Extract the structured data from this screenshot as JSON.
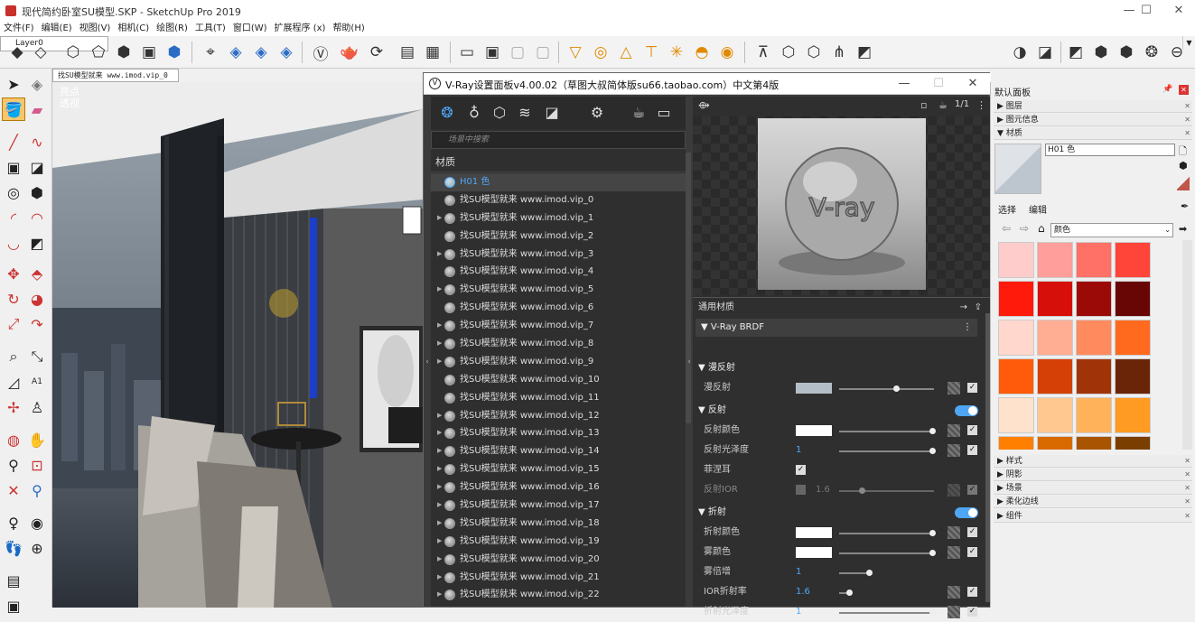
{
  "window": {
    "title": "现代简约卧室SU模型.SKP - SketchUp Pro 2019",
    "min": "—",
    "max": "☐",
    "close": "✕"
  },
  "menu": [
    "文件(F)",
    "编辑(E)",
    "视图(V)",
    "相机(C)",
    "绘图(R)",
    "工具(T)",
    "窗口(W)",
    "扩展程序 (x)",
    "帮助(H)"
  ],
  "toolbar": {
    "layer": "Layer0"
  },
  "scene_tab": "找SU模型就来 www.imod.vip_0",
  "viewport_labels": {
    "style": "亮点",
    "projection": "透视"
  },
  "vray": {
    "title": "V-Ray设置面板v4.00.02（草图大叔简体版su66.taobao.com）中文第4版",
    "search_placeholder": "场景中搜索",
    "materials_header": "材质",
    "selected_material": "H01 色",
    "materials": [
      "找SU模型就来 www.imod.vip_0",
      "找SU模型就来 www.imod.vip_1",
      "找SU模型就来 www.imod.vip_2",
      "找SU模型就来 www.imod.vip_3",
      "找SU模型就来 www.imod.vip_4",
      "找SU模型就来 www.imod.vip_5",
      "找SU模型就来 www.imod.vip_6",
      "找SU模型就来 www.imod.vip_7",
      "找SU模型就来 www.imod.vip_8",
      "找SU模型就来 www.imod.vip_9",
      "找SU模型就来 www.imod.vip_10",
      "找SU模型就来 www.imod.vip_11",
      "找SU模型就来 www.imod.vip_12",
      "找SU模型就来 www.imod.vip_13",
      "找SU模型就来 www.imod.vip_14",
      "找SU模型就来 www.imod.vip_15",
      "找SU模型就来 www.imod.vip_16",
      "找SU模型就来 www.imod.vip_17",
      "找SU模型就来 www.imod.vip_18",
      "找SU模型就来 www.imod.vip_19",
      "找SU模型就来 www.imod.vip_20",
      "找SU模型就来 www.imod.vip_21",
      "找SU模型就来 www.imod.vip_22"
    ],
    "preview_text": "V-ray",
    "preview_counter": "1/1",
    "props_header": "通用材质",
    "brdf": "V-Ray BRDF",
    "diffuse_section": "漫反射",
    "diffuse": {
      "label": "漫反射",
      "color": "#b4bec6"
    },
    "reflection_section": "反射",
    "refl_color": {
      "label": "反射颜色",
      "color": "#ffffff"
    },
    "refl_gloss": {
      "label": "反射光泽度",
      "value": "1"
    },
    "fresnel": {
      "label": "菲涅耳"
    },
    "refl_ior": {
      "label": "反射IOR",
      "value": "1.6"
    },
    "refraction_section": "折射",
    "refr_color": {
      "label": "折射颜色",
      "color": "#ffffff"
    },
    "fog_color": {
      "label": "雾颜色",
      "color": "#ffffff"
    },
    "fog_mult": {
      "label": "雾倍增",
      "value": "1"
    },
    "ior": {
      "label": "IOR折射率",
      "value": "1.6"
    },
    "refr_gloss": {
      "label": "折射光泽度",
      "value": "1"
    }
  },
  "tray": {
    "title": "默认面板",
    "panels": {
      "layers": "图层",
      "entity_info": "图元信息",
      "materials": "材质",
      "styles": "样式",
      "shadows": "阴影",
      "scenes": "场景",
      "soften": "柔化边线",
      "components": "组件"
    },
    "material_name": "H01 色",
    "tab_select": "选择",
    "tab_edit": "编辑",
    "library": "颜色",
    "swatches": [
      "#ffcccc",
      "#ff9e9a",
      "#ff7067",
      "#ff443a",
      "#ff1a0c",
      "#d60f0a",
      "#9c0a08",
      "#680606",
      "#ffd7cc",
      "#ffae94",
      "#ff8a5e",
      "#ff6a1f",
      "#ff5b0a",
      "#d44006",
      "#a03408",
      "#6a2408",
      "#ffe2cc",
      "#ffc890",
      "#ffb25a",
      "#ff9a22",
      "#ff8000",
      "#d86a00",
      "#a85400",
      "#7a3e00"
    ]
  }
}
